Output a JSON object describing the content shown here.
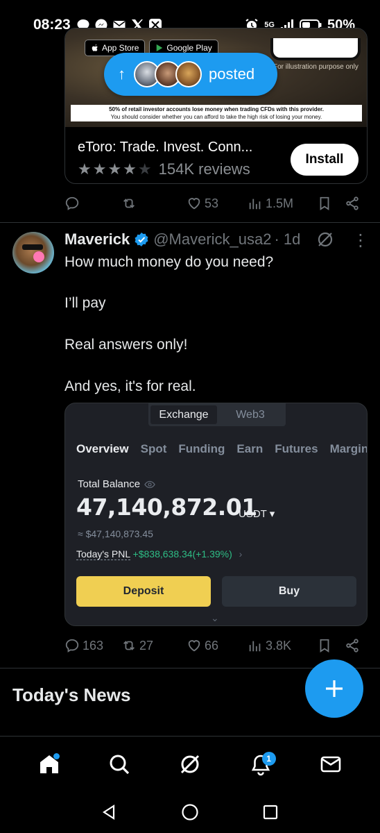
{
  "status_bar": {
    "time": "08:23",
    "network": "5G",
    "battery": "50%",
    "left_icons": [
      "chat-bubble-icon",
      "messenger-icon",
      "mail-icon",
      "x-logo-icon",
      "x-app-icon"
    ],
    "right_icons": [
      "alarm-icon",
      "signal-icon",
      "battery-icon"
    ]
  },
  "ad": {
    "app_store_small": "Download on the",
    "app_store": "App Store",
    "google_play_small": "GET IT ON",
    "google_play": "Google Play",
    "illustration_note": "For illustration purpose only",
    "disclaimer_bold": "50% of retail investor accounts lose money when trading CFDs with this provider.",
    "disclaimer": "You should consider whether you can afford to take the high risk of losing your money.",
    "title": "eToro: Trade. Invest. Conn...",
    "stars": "★★★★★",
    "star_rating": 4,
    "reviews": "154K reviews",
    "install_label": "Install"
  },
  "posted_pill": {
    "label": "posted"
  },
  "ad_actions": {
    "replies": "",
    "reposts": "",
    "likes": "53",
    "views": "1.5M"
  },
  "tweet": {
    "name": "Maverick",
    "handle": "@Maverick_usa2",
    "time": "· 1d",
    "lines": [
      "How much money do you need?",
      "I’ll pay",
      "Real answers only!",
      "And yes, it's for real."
    ],
    "actions": {
      "replies": "163",
      "reposts": "27",
      "likes": "66",
      "views": "3.8K"
    }
  },
  "screenshot": {
    "toggle": [
      "Exchange",
      "Web3"
    ],
    "tabs": [
      "Overview",
      "Spot",
      "Funding",
      "Earn",
      "Futures",
      "Margin"
    ],
    "balance_label": "Total Balance",
    "balance": "47,140,872.01",
    "unit": "USDT ▾",
    "usd_equiv": "≈ $47,140,873.45",
    "pnl_label": "Today's PNL",
    "pnl_value": "+$838,638.34(+1.39%)",
    "pnl_chevron": "›",
    "deposit_label": "Deposit",
    "buy_label": "Buy",
    "expand": "⌄"
  },
  "news": {
    "title": "Today's News"
  },
  "bottom_nav": {
    "items": [
      "home-icon",
      "search-icon",
      "grok-icon",
      "notifications-icon",
      "messages-icon"
    ],
    "notification_count": "1"
  },
  "colors": {
    "accent": "#1d9bf0",
    "background": "#000000",
    "muted": "#71767b",
    "deposit_yellow": "#f0cf52",
    "pnl_green": "#2ebd85"
  }
}
